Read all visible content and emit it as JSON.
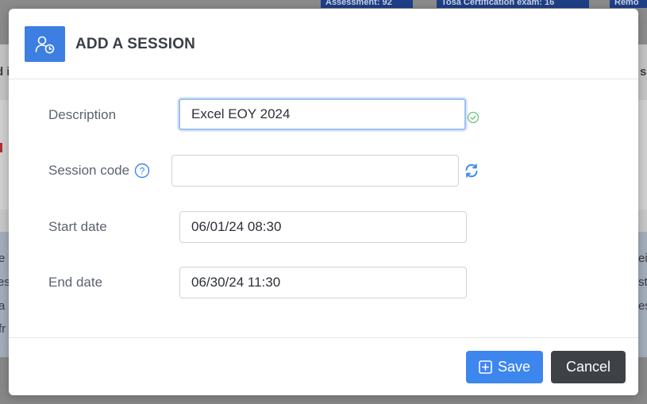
{
  "background": {
    "badges": [
      "Assessment: 92",
      "Tosa Certification exam: 16",
      "Remo"
    ],
    "edge_fragments": [
      "d i",
      "s",
      "e",
      "es",
      "a",
      "fr",
      "ei",
      "st",
      "es"
    ]
  },
  "modal": {
    "title": "ADD A SESSION",
    "header_icon": "user-clock-icon",
    "fields": {
      "description": {
        "label": "Description",
        "value": "Excel EOY 2024",
        "status_icon": "check-circle-icon"
      },
      "session_code": {
        "label": "Session code",
        "value": "",
        "help_icon": "question-circle-icon",
        "action_icon": "refresh-icon"
      },
      "start_date": {
        "label": "Start date",
        "value": "06/01/24 08:30"
      },
      "end_date": {
        "label": "End date",
        "value": "06/30/24 11:30"
      }
    },
    "buttons": {
      "save": {
        "label": "Save",
        "icon": "plus-square-icon",
        "color": "#3d86ee"
      },
      "cancel": {
        "label": "Cancel",
        "color": "#3e4247"
      }
    },
    "accent_color": "#3d7fe0"
  }
}
